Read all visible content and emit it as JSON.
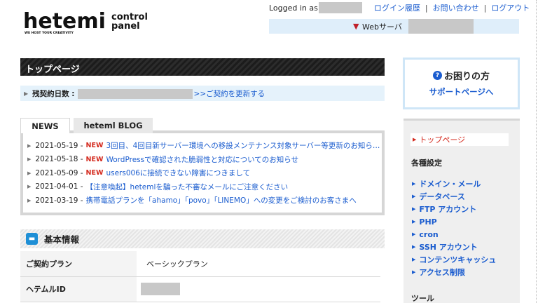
{
  "brand": {
    "logo_text": "hetemi",
    "tagline": "WE HOST YOUR CREATIVITY",
    "control": "control",
    "panel": "panel"
  },
  "header": {
    "logged_in_as": "Logged in as",
    "links": [
      "ログイン履歴",
      "お問い合わせ",
      "ログアウト"
    ],
    "separator": "|",
    "server_label": "Webサーバ"
  },
  "main": {
    "page_title": "トップページ",
    "remaining_label": "残契約日数 :",
    "renew_link": ">>ご契約を更新する",
    "tabs": [
      "NEWS",
      "heteml BLOG"
    ],
    "news": [
      {
        "date": "2021-05-19 -",
        "new": "NEW",
        "title": "3回目、4回目新サーバー環境への移設メンテナンス対象サーバー等更新のお知ら…"
      },
      {
        "date": "2021-05-18 -",
        "new": "NEW",
        "title": "WordPressで確認された脆弱性と対応についてのお知らせ"
      },
      {
        "date": "2021-05-09 -",
        "new": "NEW",
        "title": "users006に接続できない障害につきまして"
      },
      {
        "date": "2021-04-01 -",
        "new": "",
        "title": "【注意喚起】hetemlを騙った不審なメールにご注意ください"
      },
      {
        "date": "2021-03-19 -",
        "new": "",
        "title": "携帯電話プランを「ahamo」「povo」「LINEMO」への変更をご検討のお客さまへ"
      }
    ],
    "basic_info": {
      "title": "基本情報",
      "rows": [
        {
          "key": "ご契約プラン",
          "value": "ベーシックプラン"
        },
        {
          "key": "ヘテムルID",
          "value": ""
        }
      ]
    }
  },
  "sidebar": {
    "help_title": "お困りの方",
    "help_link": "サポートページへ",
    "top_link": "トップページ",
    "section_settings": "各種設定",
    "menu": [
      "ドメイン・メール",
      "データベース",
      "FTP アカウント",
      "PHP",
      "cron",
      "SSH アカウント",
      "コンテンツキャッシュ",
      "アクセス制限"
    ],
    "section_tools": "ツール"
  },
  "colors": {
    "link": "#1a5ccf",
    "new_badge": "#d42a1e",
    "info_bg": "#e5f2fb",
    "header_dark": "#1c1c1c"
  }
}
